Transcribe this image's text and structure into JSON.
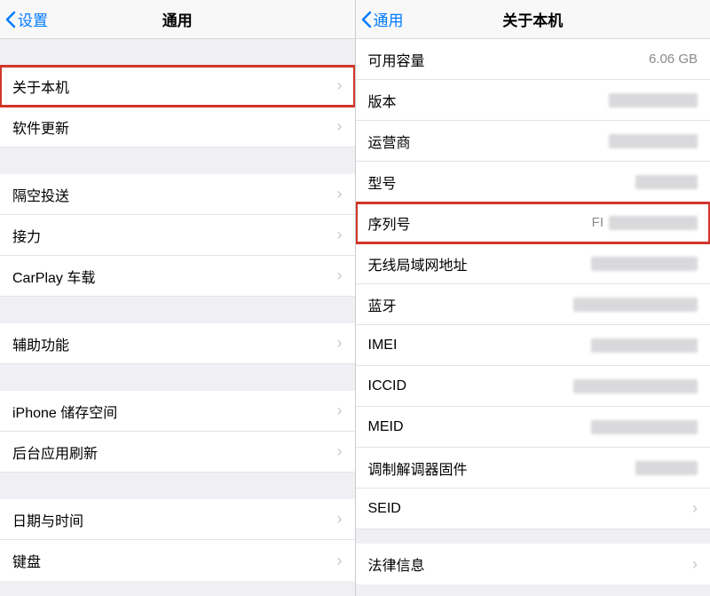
{
  "left": {
    "back_label": "设置",
    "title": "通用",
    "items": {
      "about": "关于本机",
      "software_update": "软件更新",
      "airdrop": "隔空投送",
      "handoff": "接力",
      "carplay": "CarPlay 车载",
      "accessibility": "辅助功能",
      "storage": "iPhone 储存空间",
      "bg_refresh": "后台应用刷新",
      "date_time": "日期与时间",
      "keyboard": "键盘"
    }
  },
  "right": {
    "back_label": "通用",
    "title": "关于本机",
    "rows": {
      "available": {
        "label": "可用容量",
        "value": "6.06 GB"
      },
      "version": {
        "label": "版本"
      },
      "carrier": {
        "label": "运营商"
      },
      "model": {
        "label": "型号"
      },
      "serial": {
        "label": "序列号",
        "value_prefix": "FI"
      },
      "wifi_addr": {
        "label": "无线局域网地址"
      },
      "bluetooth": {
        "label": "蓝牙"
      },
      "imei": {
        "label": "IMEI"
      },
      "iccid": {
        "label": "ICCID"
      },
      "meid": {
        "label": "MEID"
      },
      "modem_fw": {
        "label": "调制解调器固件"
      },
      "seid": {
        "label": "SEID"
      },
      "legal": {
        "label": "法律信息"
      }
    }
  }
}
